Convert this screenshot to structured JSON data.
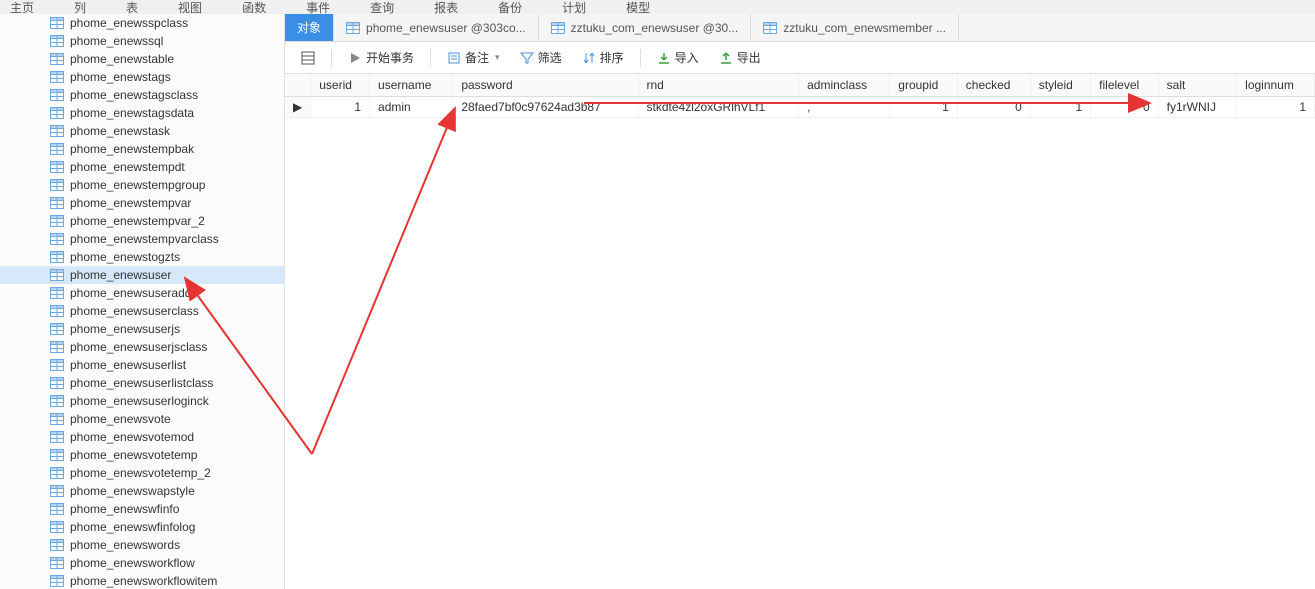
{
  "top_menu": {
    "items": [
      "主页",
      "列",
      "表",
      "视图",
      "函数",
      "事件",
      "查询",
      "报表",
      "备份",
      "计划",
      "模型"
    ]
  },
  "sidebar": {
    "items": [
      "phome_enewsspclass",
      "phome_enewssql",
      "phome_enewstable",
      "phome_enewstags",
      "phome_enewstagsclass",
      "phome_enewstagsdata",
      "phome_enewstask",
      "phome_enewstempbak",
      "phome_enewstempdt",
      "phome_enewstempgroup",
      "phome_enewstempvar",
      "phome_enewstempvar_2",
      "phome_enewstempvarclass",
      "phome_enewstogzts",
      "phome_enewsuser",
      "phome_enewsuseradd",
      "phome_enewsuserclass",
      "phome_enewsuserjs",
      "phome_enewsuserjsclass",
      "phome_enewsuserlist",
      "phome_enewsuserlistclass",
      "phome_enewsuserloginck",
      "phome_enewsvote",
      "phome_enewsvotemod",
      "phome_enewsvotetemp",
      "phome_enewsvotetemp_2",
      "phome_enewswapstyle",
      "phome_enewswfinfo",
      "phome_enewswfinfolog",
      "phome_enewswords",
      "phome_enewsworkflow",
      "phome_enewsworkflowitem"
    ],
    "selected_index": 14
  },
  "tabs": {
    "active_index": 0,
    "items": [
      {
        "label": "对象",
        "icon": null
      },
      {
        "label": "phome_enewsuser @303co...",
        "icon": "table"
      },
      {
        "label": "zztuku_com_enewsuser @30...",
        "icon": "table"
      },
      {
        "label": "zztuku_com_enewsmember ...",
        "icon": "table"
      }
    ]
  },
  "toolbar": {
    "start_tx": "开始事务",
    "remark": "备注",
    "filter": "筛选",
    "sort": "排序",
    "import": "导入",
    "export": "导出"
  },
  "grid": {
    "columns": [
      "userid",
      "username",
      "password",
      "rnd",
      "adminclass",
      "groupid",
      "checked",
      "styleid",
      "filelevel",
      "salt",
      "loginnum"
    ],
    "rows": [
      {
        "userid": "1",
        "username": "admin",
        "password": "28faed7bf0c97624ad3b87",
        "rnd": "stkdte4zl2oxGRlhVLf1",
        "adminclass": ",",
        "groupid": "1",
        "checked": "0",
        "styleid": "1",
        "filelevel": "0",
        "salt": "fy1rWNIJ",
        "loginnum": "1"
      }
    ]
  },
  "colors": {
    "arrow": "#e63333"
  }
}
